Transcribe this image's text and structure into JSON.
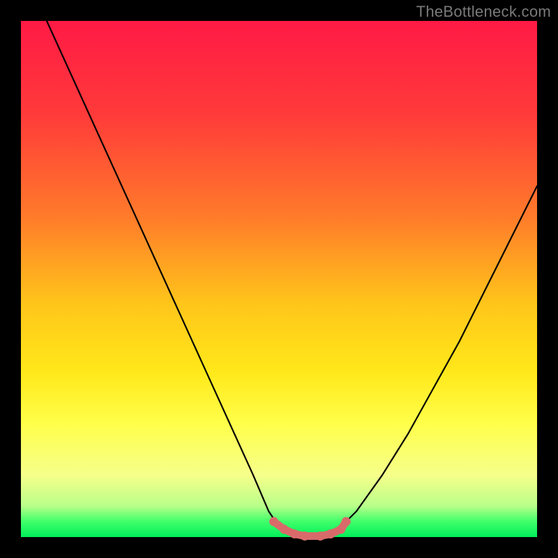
{
  "watermark": "TheBottleneck.com",
  "chart_data": {
    "type": "line",
    "title": "",
    "xlabel": "",
    "ylabel": "",
    "xlim": [
      0,
      100
    ],
    "ylim": [
      0,
      100
    ],
    "series": [
      {
        "name": "curve",
        "x": [
          5,
          10,
          15,
          20,
          25,
          30,
          35,
          40,
          45,
          48,
          50,
          52,
          55,
          58,
          60,
          62,
          65,
          70,
          75,
          80,
          85,
          90,
          95,
          100
        ],
        "values": [
          100,
          89,
          78,
          67,
          56,
          45,
          34,
          23,
          12,
          5,
          2,
          0.5,
          0,
          0,
          0.5,
          2,
          5,
          12,
          20,
          29,
          38,
          48,
          58,
          68
        ]
      },
      {
        "name": "valley-highlight",
        "x": [
          49,
          51,
          53,
          55,
          58,
          60,
          62,
          63
        ],
        "values": [
          3,
          1.5,
          0.6,
          0.2,
          0.2,
          0.6,
          1.5,
          3
        ]
      }
    ],
    "background_gradient": {
      "top": "#ff1a45",
      "mid1": "#ffc61a",
      "mid2": "#ffff4a",
      "bottom": "#00ef5a"
    }
  }
}
